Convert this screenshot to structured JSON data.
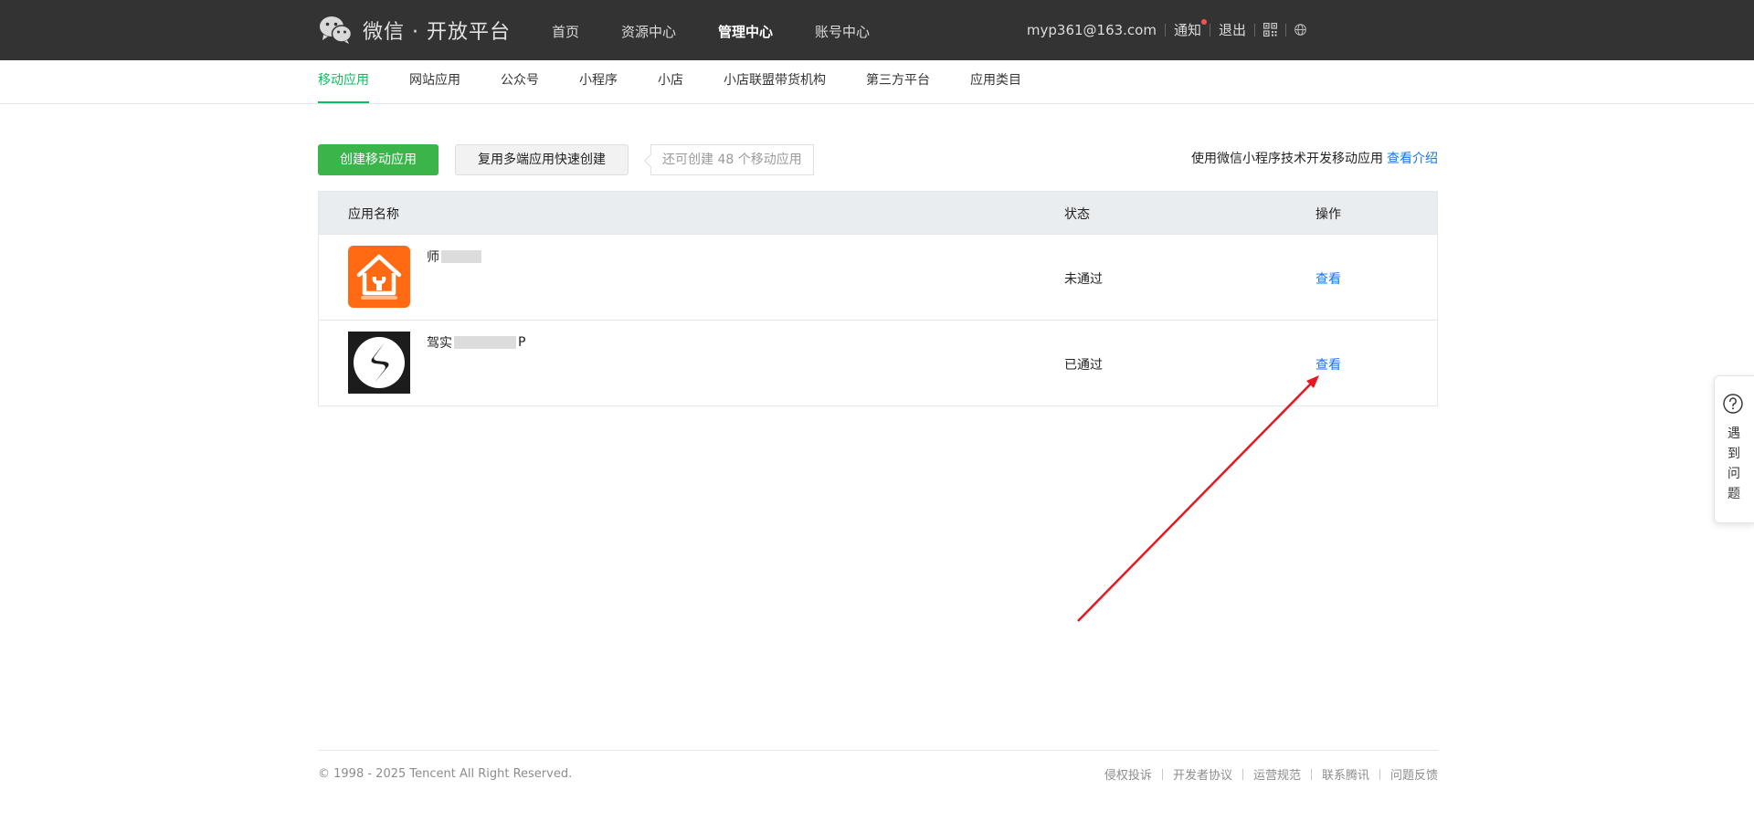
{
  "header": {
    "brand": "微信 · 开放平台",
    "nav": [
      {
        "label": "首页",
        "active": false
      },
      {
        "label": "资源中心",
        "active": false
      },
      {
        "label": "管理中心",
        "active": true
      },
      {
        "label": "账号中心",
        "active": false
      }
    ],
    "email": "myp361@163.com",
    "notify_label": "通知",
    "logout_label": "退出",
    "icons": [
      "qrcode-icon",
      "globe-icon"
    ]
  },
  "subnav": {
    "items": [
      {
        "label": "移动应用",
        "active": true
      },
      {
        "label": "网站应用",
        "active": false
      },
      {
        "label": "公众号",
        "active": false
      },
      {
        "label": "小程序",
        "active": false
      },
      {
        "label": "小店",
        "active": false
      },
      {
        "label": "小店联盟带货机构",
        "active": false
      },
      {
        "label": "第三方平台",
        "active": false
      },
      {
        "label": "应用类目",
        "active": false
      }
    ]
  },
  "actions": {
    "create_label": "创建移动应用",
    "reuse_label": "复用多端应用快速创建",
    "quota_text": "还可创建 48 个移动应用",
    "intro_text": "使用微信小程序技术开发移动应用",
    "intro_link": "查看介绍"
  },
  "table": {
    "headers": {
      "name": "应用名称",
      "status": "状态",
      "op": "操作"
    },
    "rows": [
      {
        "name_visible_prefix": "师",
        "name_visible_suffix": "",
        "status": "未通过",
        "op": "查看"
      },
      {
        "name_visible_prefix": "驾实",
        "name_visible_suffix": "P",
        "status": "已通过",
        "op": "查看"
      }
    ]
  },
  "footer": {
    "copyright": "© 1998 - 2025 Tencent All Right Reserved.",
    "links": [
      "侵权投诉",
      "开发者协议",
      "运营规范",
      "联系腾讯",
      "问题反馈"
    ]
  },
  "help": {
    "label": "遇到问题"
  },
  "colors": {
    "topbar": "#333334",
    "primary_green": "#3bb54a",
    "active_tab": "#07c160",
    "link_blue": "#1b74e4",
    "annotation_arrow": "#e8161f",
    "app1_icon_bg": "#ff6a13"
  }
}
